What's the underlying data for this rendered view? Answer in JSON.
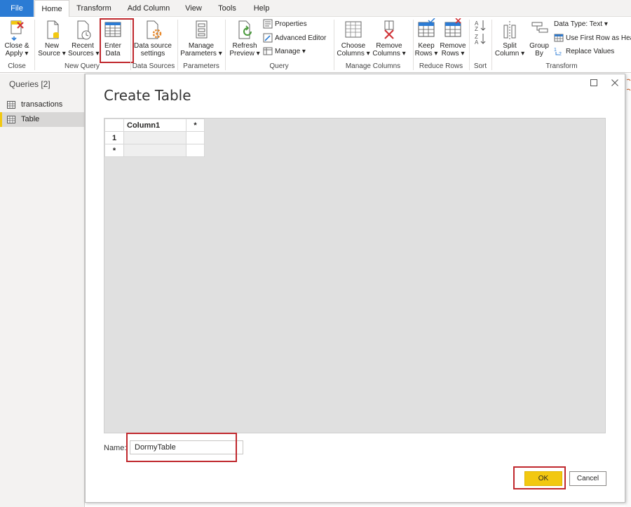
{
  "menu": {
    "tabs": [
      {
        "label": "File"
      },
      {
        "label": "Home"
      },
      {
        "label": "Transform"
      },
      {
        "label": "Add Column"
      },
      {
        "label": "View"
      },
      {
        "label": "Tools"
      },
      {
        "label": "Help"
      }
    ],
    "active_tab": "Home"
  },
  "ribbon": {
    "groups": {
      "close": "Close",
      "new_query": "New Query",
      "data_sources": "Data Sources",
      "parameters": "Parameters",
      "query": "Query",
      "manage_columns": "Manage Columns",
      "reduce_rows": "Reduce Rows",
      "sort": "Sort",
      "transform": "Transform"
    },
    "buttons": {
      "close_apply": [
        "Close &",
        "Apply ▾"
      ],
      "new_source": [
        "New",
        "Source ▾"
      ],
      "recent_sources": [
        "Recent",
        "Sources ▾"
      ],
      "enter_data": [
        "Enter",
        "Data"
      ],
      "data_source_settings": [
        "Data source",
        "settings"
      ],
      "manage_parameters": [
        "Manage",
        "Parameters ▾"
      ],
      "refresh_preview": [
        "Refresh",
        "Preview ▾"
      ],
      "properties": "Properties",
      "advanced_editor": "Advanced Editor",
      "manage": "Manage ▾",
      "choose_columns": [
        "Choose",
        "Columns ▾"
      ],
      "remove_columns": [
        "Remove",
        "Columns ▾"
      ],
      "keep_rows": [
        "Keep",
        "Rows ▾"
      ],
      "remove_rows": [
        "Remove",
        "Rows ▾"
      ],
      "split_column": [
        "Split",
        "Column ▾"
      ],
      "group_by": [
        "Group",
        "By"
      ],
      "data_type": "Data Type: Text ▾",
      "use_first_row": "Use First Row as Hea",
      "replace_values": "Replace Values"
    }
  },
  "queries": {
    "title": "Queries [2]",
    "items": [
      {
        "label": "transactions"
      },
      {
        "label": "Table"
      }
    ],
    "selected": "Table"
  },
  "dialog": {
    "title": "Create Table",
    "grid": {
      "header_column": "Column1",
      "add_column_marker": "*",
      "row_labels": [
        "1",
        "*"
      ]
    },
    "name_label": "Name:",
    "name_value": "DormyTable",
    "ok_label": "OK",
    "cancel_label": "Cancel"
  },
  "highlight_color": "#c0282d",
  "accent_color": "#f2c811",
  "file_tab_color": "#2b7bd4"
}
